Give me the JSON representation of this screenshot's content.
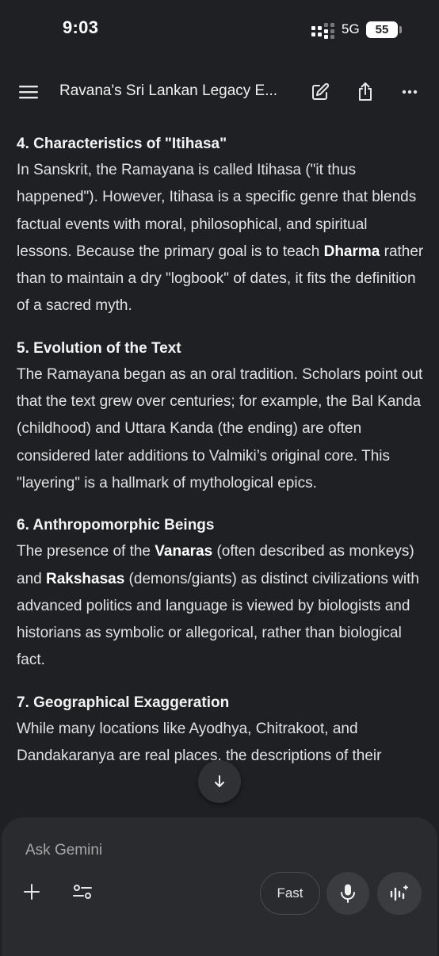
{
  "status_bar": {
    "time": "9:03",
    "network": "5G",
    "battery": "55"
  },
  "app_bar": {
    "title": "Ravana's Sri Lankan Legacy E..."
  },
  "content": {
    "s4_heading": "4. Characteristics of \"Itihasa\"",
    "s4_p1": "In Sanskrit, the Ramayana is called Itihasa (\"it thus happened\"). However, Itihasa is a specific genre that blends factual events with moral, philosophical, and spiritual lessons. Because the primary goal is to teach ",
    "s4_bold": "Dharma",
    "s4_p2": " rather than to maintain a dry \"logbook\" of dates, it fits the definition of a sacred myth.",
    "s5_heading": "5. Evolution of the Text",
    "s5_p": "The Ramayana began as an oral tradition. Scholars point out that the text grew over centuries; for example, the Bal Kanda (childhood) and Uttara Kanda (the ending) are often considered later additions to Valmiki’s original core. This \"layering\" is a hallmark of mythological epics.",
    "s6_heading": "6. Anthropomorphic Beings",
    "s6_p1": "The presence of the ",
    "s6_bold1": "Vanaras",
    "s6_p2": " (often described as monkeys) and ",
    "s6_bold2": "Rakshasas",
    "s6_p3": " (demons/giants) as distinct civilizations with advanced politics and language is viewed by biologists and historians as symbolic or allegorical, rather than biological fact.",
    "s7_heading": "7. Geographical Exaggeration",
    "s7_p": "While many locations like Ayodhya, Chitrakoot, and Dandakaranya are real places, the descriptions of their"
  },
  "composer": {
    "placeholder": "Ask Gemini",
    "mode_label": "Fast"
  },
  "icons": {
    "menu": "menu-icon",
    "edit": "edit-icon",
    "share": "share-icon",
    "more": "more-icon",
    "scroll": "arrow-down-icon",
    "plus": "plus-icon",
    "tune": "tune-icon",
    "mic": "mic-icon",
    "live": "live-icon"
  }
}
